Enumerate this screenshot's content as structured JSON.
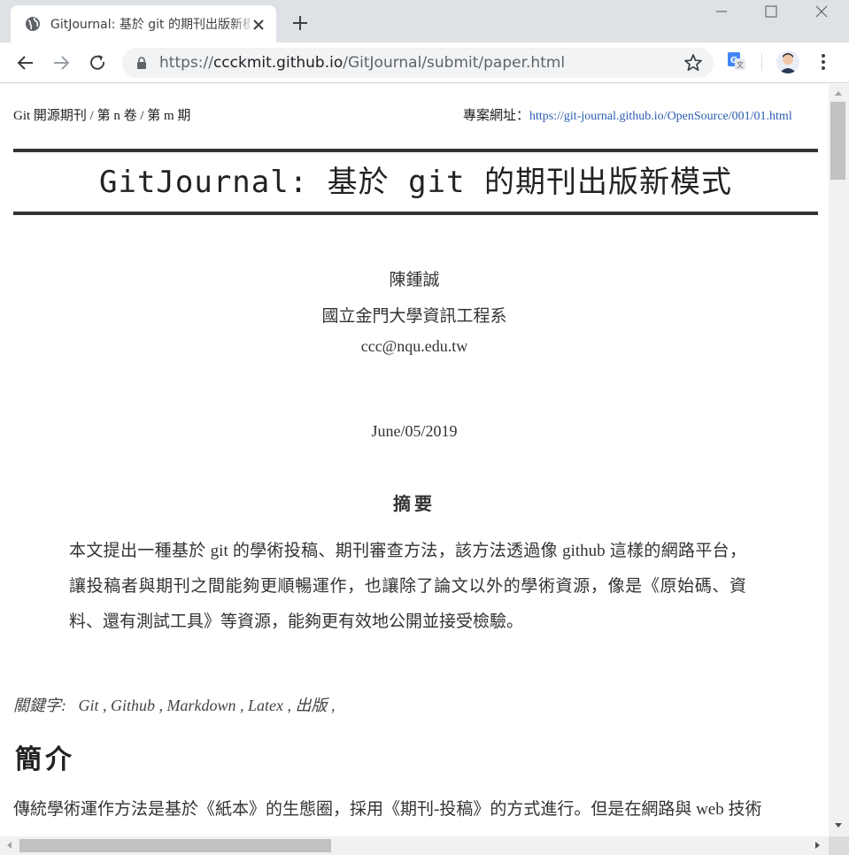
{
  "browser": {
    "tab_title": "GitJournal: 基於 git 的期刊出版新模式",
    "url_scheme": "https://",
    "url_host": "ccckmit.github.io",
    "url_path": "/GitJournal/submit/paper.html"
  },
  "paper": {
    "header_left": "Git 開源期刊 / 第 n 卷 / 第 m 期",
    "header_right_label": "專案網址：",
    "header_right_link": "https://git-journal.github.io/OpenSource/001/01.html",
    "title": "GitJournal: 基於 git 的期刊出版新模式",
    "author": "陳鍾誠",
    "affiliation": "國立金門大學資訊工程系",
    "email": "ccc@nqu.edu.tw",
    "date": "June/05/2019",
    "abstract_title": "摘要",
    "abstract": "本文提出一種基於 git 的學術投稿、期刊審查方法，該方法透過像 github 這樣的網路平台，讓投稿者與期刊之間能夠更順暢運作，也讓除了論文以外的學術資源，像是《原始碼、資料、還有測試工具》等資源，能夠更有效地公開並接受檢驗。",
    "keywords_label": "關鍵字:",
    "keywords": "Git , Github , Markdown , Latex , 出版 ,",
    "intro_heading": "簡介",
    "intro_paragraph": "傳統學術運作方法是基於《紙本》的生態圈，採用《期刊-投稿》的方式進行。但是在網路與 web 技術"
  },
  "colors": {
    "link": "#2a5db0",
    "chrome_bg": "#dee1e6",
    "rule": "#333333"
  },
  "icons": [
    "globe-icon",
    "close-icon",
    "plus-icon",
    "back-icon",
    "forward-icon",
    "reload-icon",
    "lock-icon",
    "star-icon",
    "translate-icon",
    "avatar",
    "more-icon"
  ]
}
